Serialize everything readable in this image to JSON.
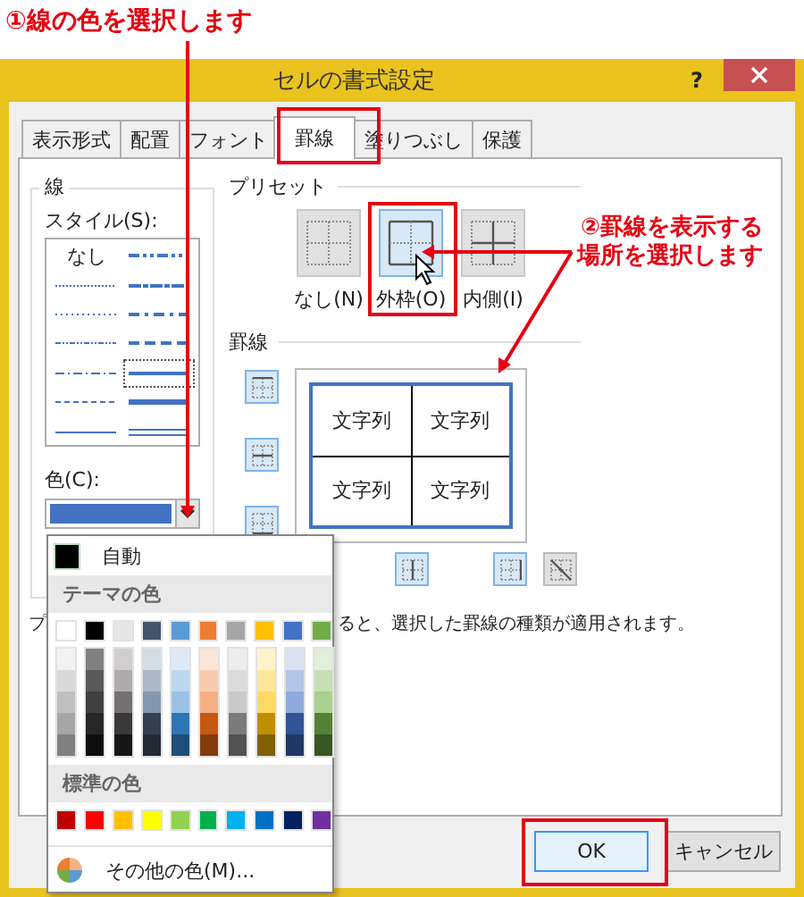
{
  "callouts": [
    {
      "text": "①線の色を選択します"
    },
    {
      "text": "②罫線を表示する"
    },
    {
      "text": "場所を選択します"
    }
  ],
  "window": {
    "title": "セルの書式設定",
    "help": "?"
  },
  "tabs": [
    {
      "label": "表示形式",
      "selected": false
    },
    {
      "label": "配置",
      "selected": false
    },
    {
      "label": "フォント",
      "selected": false
    },
    {
      "label": "罫線",
      "selected": true
    },
    {
      "label": "塗りつぶし",
      "selected": false
    },
    {
      "label": "保護",
      "selected": false
    }
  ],
  "line": {
    "title": "線",
    "style_label": "スタイル(S):",
    "styles": [
      {
        "kind": "none",
        "label": "なし",
        "selected": false
      },
      {
        "kind": "medium-dash-dot-dot",
        "selected": false
      },
      {
        "kind": "hair",
        "selected": false
      },
      {
        "kind": "slant-dash-dot",
        "selected": false
      },
      {
        "kind": "dotted",
        "selected": false
      },
      {
        "kind": "medium-dash-dot",
        "selected": false
      },
      {
        "kind": "dash-dot-dot",
        "selected": false
      },
      {
        "kind": "medium-dashed",
        "selected": false
      },
      {
        "kind": "dash-dot",
        "selected": false
      },
      {
        "kind": "medium",
        "selected": true
      },
      {
        "kind": "dashed",
        "selected": false
      },
      {
        "kind": "thick",
        "selected": false
      },
      {
        "kind": "thin",
        "selected": false
      },
      {
        "kind": "double",
        "selected": false
      }
    ],
    "color_label": "色(C):",
    "color": "#4472c4"
  },
  "presets": {
    "title": "プリセット",
    "items": [
      {
        "kind": "none",
        "label": "なし(N)",
        "selected": false
      },
      {
        "kind": "outline",
        "label": "外枠(O)",
        "selected": true
      },
      {
        "kind": "inside",
        "label": "内側(I)",
        "selected": false
      }
    ]
  },
  "border": {
    "title": "罫線",
    "side_buttons": [
      {
        "kind": "top",
        "on": true
      },
      {
        "kind": "inside-h",
        "on": true
      },
      {
        "kind": "bottom",
        "on": true
      }
    ],
    "bottom_buttons": [
      {
        "kind": "inside-v",
        "on": true
      },
      {
        "kind": "right",
        "on": true
      },
      {
        "kind": "diagonal-down",
        "on": false
      }
    ],
    "preview": [
      "文字列",
      "文字列",
      "文字列",
      "文字列"
    ]
  },
  "description": [
    "プ",
    "ると、選択した罫線の種類が適用されます。"
  ],
  "color_menu": {
    "auto_label": "自動",
    "theme_title": "テーマの色",
    "theme": [
      {
        "color": "#ffffff",
        "tints": [
          {
            "color": "#f2f2f2"
          },
          {
            "color": "#d9d9d9"
          },
          {
            "color": "#bfbfbf"
          },
          {
            "color": "#a6a6a6"
          },
          {
            "color": "#808080"
          }
        ]
      },
      {
        "color": "#000000",
        "tints": [
          {
            "color": "#808080"
          },
          {
            "color": "#595959"
          },
          {
            "color": "#404040"
          },
          {
            "color": "#262626"
          },
          {
            "color": "#0d0d0d"
          }
        ]
      },
      {
        "color": "#e7e6e6",
        "tints": [
          {
            "color": "#d0cece"
          },
          {
            "color": "#aeabab"
          },
          {
            "color": "#767171"
          },
          {
            "color": "#3a3838"
          },
          {
            "color": "#171616"
          }
        ]
      },
      {
        "color": "#44546a",
        "tints": [
          {
            "color": "#d6dce4"
          },
          {
            "color": "#adb9ca"
          },
          {
            "color": "#8497b0"
          },
          {
            "color": "#333f4f"
          },
          {
            "color": "#222a35"
          }
        ]
      },
      {
        "color": "#5b9bd5",
        "tints": [
          {
            "color": "#ddebf7"
          },
          {
            "color": "#bdd7ee"
          },
          {
            "color": "#9bc2e6"
          },
          {
            "color": "#2f75b5"
          },
          {
            "color": "#1f4e78"
          }
        ]
      },
      {
        "color": "#ed7d31",
        "tints": [
          {
            "color": "#fce4d6"
          },
          {
            "color": "#f8cbad"
          },
          {
            "color": "#f4b084"
          },
          {
            "color": "#c65911"
          },
          {
            "color": "#833c0c"
          }
        ]
      },
      {
        "color": "#a5a5a5",
        "tints": [
          {
            "color": "#ededed"
          },
          {
            "color": "#dbdbdb"
          },
          {
            "color": "#c9c9c9"
          },
          {
            "color": "#7b7b7b"
          },
          {
            "color": "#525252"
          }
        ]
      },
      {
        "color": "#ffc000",
        "tints": [
          {
            "color": "#fff2cc"
          },
          {
            "color": "#ffe699"
          },
          {
            "color": "#ffd966"
          },
          {
            "color": "#bf8f00"
          },
          {
            "color": "#806000"
          }
        ]
      },
      {
        "color": "#4472c4",
        "tints": [
          {
            "color": "#d9e1f2"
          },
          {
            "color": "#b4c6e7"
          },
          {
            "color": "#8ea9db"
          },
          {
            "color": "#305496"
          },
          {
            "color": "#203764"
          }
        ]
      },
      {
        "color": "#70ad47",
        "tints": [
          {
            "color": "#e2efda"
          },
          {
            "color": "#c6e0b4"
          },
          {
            "color": "#a9d08e"
          },
          {
            "color": "#548235"
          },
          {
            "color": "#375623"
          }
        ]
      }
    ],
    "standard_title": "標準の色",
    "standard": [
      {
        "color": "#c00000"
      },
      {
        "color": "#ff0000"
      },
      {
        "color": "#ffc000"
      },
      {
        "color": "#ffff00"
      },
      {
        "color": "#92d050"
      },
      {
        "color": "#00b050"
      },
      {
        "color": "#00b0f0"
      },
      {
        "color": "#0070c0"
      },
      {
        "color": "#002060"
      },
      {
        "color": "#7030a0"
      }
    ],
    "more_label": "その他の色(M)..."
  },
  "buttons": [
    {
      "label": "OK",
      "kind": "default"
    },
    {
      "label": "キャンセル",
      "kind": "normal"
    }
  ]
}
